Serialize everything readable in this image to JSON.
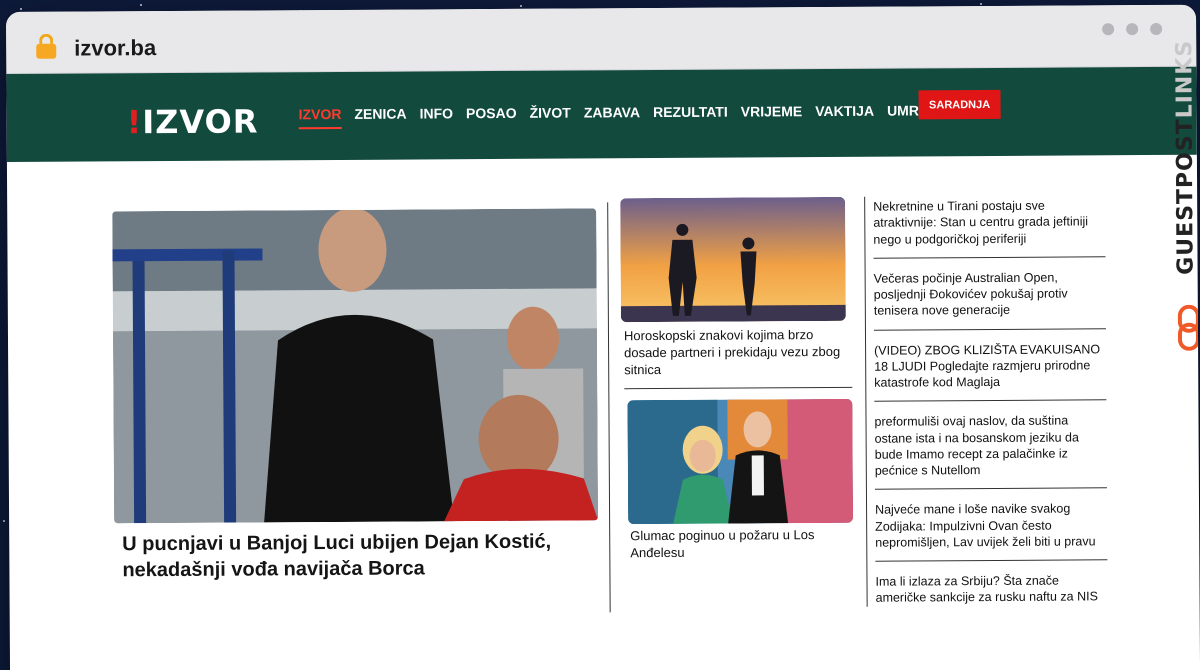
{
  "browser": {
    "url": "izvor.ba"
  },
  "site": {
    "logo": "IZVOR",
    "logo_mark": "!",
    "nav": [
      {
        "label": "IZVOR",
        "active": true
      },
      {
        "label": "ZENICA",
        "active": false
      },
      {
        "label": "INFO",
        "active": false
      },
      {
        "label": "POSAO",
        "active": false
      },
      {
        "label": "ŽIVOT",
        "active": false
      },
      {
        "label": "ZABAVA",
        "active": false
      },
      {
        "label": "REZULTATI",
        "active": false
      },
      {
        "label": "VRIJEME",
        "active": false
      },
      {
        "label": "VAKTIJA",
        "active": false
      },
      {
        "label": "UMRLI",
        "active": false
      }
    ],
    "cta": "SARADNJA",
    "colors": {
      "nav_bg": "#134a3e",
      "accent": "#e01616",
      "active_nav": "#ff3b2f"
    }
  },
  "hero": {
    "title": "U pucnjavi u Banjoj Luci ubijen Dejan Kostić, nekadašnji vođa navijača Borca"
  },
  "mid": [
    {
      "title": "Horoskopski znakovi kojima brzo dosade partneri i prekidaju vezu zbog sitnica"
    },
    {
      "title": "Glumac poginuo u požaru u Los Anđelesu"
    }
  ],
  "side": [
    "Nekretnine u Tirani postaju sve atraktivnije: Stan u centru grada jeftiniji nego u podgoričkoj periferiji",
    "Večeras počinje Australian Open, posljednji Đokovićev pokušaj protiv tenisera nove generacije",
    "(VIDEO) ZBOG KLIZIŠTA EVAKUISANO 18 LJUDI Pogledajte razmjeru prirodne katastrofe kod Maglaja",
    "preformuliši ovaj naslov, da suština ostane ista i na bosanskom jeziku da bude Imamo recept za palačinke iz pećnice s Nutellom",
    "Najveće mane i loše navike svakog Zodijaka: Impulzivni Ovan često nepromišljen, Lav uvijek želi biti u pravu",
    "Ima li izlaza za Srbiju? Šta znače američke sankcije za rusku naftu za NIS"
  ],
  "badge": {
    "text_dark": "GUESTPOST",
    "text_light": "LINKS",
    "icon": "chain-link-icon"
  }
}
